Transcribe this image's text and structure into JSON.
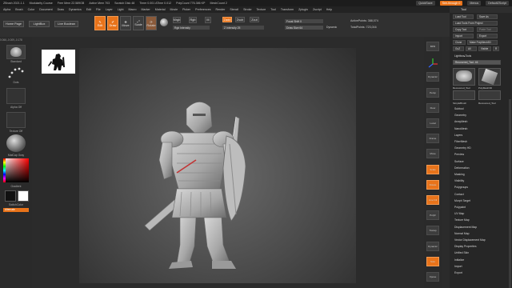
{
  "titlebar": {
    "app": "ZBrush 2021.1.1",
    "items": [
      "Modularity Course",
      "Free Mem 22.589GB",
      "Active Mem 703",
      "Scratch Disk 48",
      "Timer 0.001 ATime 0.012",
      "PolyCount 776.386 KP",
      "MeshCount 2"
    ],
    "quicksave": "QuickSave",
    "seethrough": "See-through  0",
    "menus": "Menus",
    "script": "DefaultZScript"
  },
  "menubar": [
    "Alpha",
    "Brush",
    "Color",
    "Document",
    "Draw",
    "Dynamics",
    "Edit",
    "File",
    "Layer",
    "Light",
    "Macro",
    "Marker",
    "Material",
    "Movie",
    "Picker",
    "Preferences",
    "Render",
    "Stencil",
    "Stroke",
    "Texture",
    "Tool",
    "Transform",
    "Zplugin",
    "Zscript",
    "Help"
  ],
  "toolbar": {
    "home": "Home Page",
    "lightbox": "LightBox",
    "liveboolean": "Live Boolean",
    "edit": "Edit",
    "draw": "Draw",
    "move": "Move",
    "scale": "Scale",
    "rotate": "Rotate",
    "mrgb": "Mrgb",
    "rgb": "Rgb",
    "m": "M",
    "zadd": "Zadd",
    "zsub": "Zsub",
    "zcut": "Zcut",
    "rgb_intensity": "Rgb Intensity",
    "z_intensity": "Z Intensity 25",
    "focal_shift": "Focal Shift 0",
    "draw_size": "Draw Size 64",
    "dynamic": "Dynamic",
    "active_points": "ActivePoints: 388,074",
    "total_points": "TotalPoints: 723,016"
  },
  "coords": "0.066,-0.009,-0.178",
  "left": {
    "brush": "Standard",
    "stroke": "Dots",
    "alpha": "Alpha Off",
    "texture": "Texture Off",
    "material": "MatCap Gray",
    "gradient": "Gradient",
    "switchcolor": "SwitchColor",
    "alternate": "Alternate"
  },
  "shelf": [
    "BPR",
    "SPix 3",
    "Dynamic",
    "Persp",
    "Floor",
    "Local",
    "Frame",
    "Move",
    "Scale",
    "Rotate",
    "Line Fill",
    "PolyF",
    "Transp",
    "Dynamic",
    "Solo",
    "Xpose"
  ],
  "tray": {
    "title": "Tool",
    "buttons": [
      "Load Tool",
      "Save As",
      "Load Tools From Project",
      "Copy Tool",
      "Paste Tool",
      "Import",
      "Export",
      "Clone",
      "Make PolyMesh3D",
      "GoZ",
      "All",
      "Visible",
      "R"
    ],
    "lightbox_tools": "Lightbox▸Tools",
    "recovered": "Recovered_Tool. 46",
    "thumbs": [
      "Recovered_Tool",
      "PolyMesh3D",
      "SimpleBrush",
      "Recovered_Tool"
    ],
    "subpalettes": [
      "Subtool",
      "Geometry",
      "ArrayMesh",
      "NanoMesh",
      "Layers",
      "FiberMesh",
      "Geometry HD",
      "Preview",
      "Surface",
      "Deformation",
      "Masking",
      "Visibility",
      "Polygroups",
      "Contact",
      "Morph Target",
      "Polypaint",
      "UV Map",
      "Texture Map",
      "Displacement Map",
      "Normal Map",
      "Vector Displacement Map",
      "Display Properties",
      "Unified Skin",
      "Initialize",
      "Import",
      "Export"
    ]
  },
  "colors": {
    "accent": "#e8731a",
    "panel": "#2a2a2a"
  }
}
